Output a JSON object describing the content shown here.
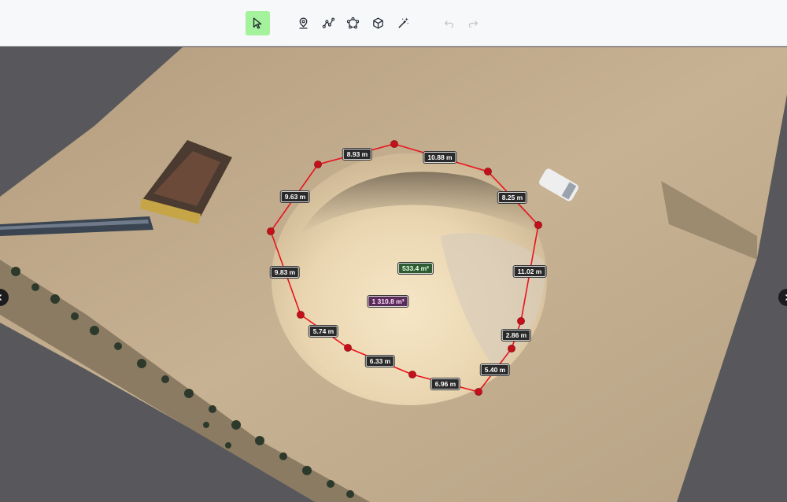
{
  "toolbar": {
    "tools": [
      {
        "name": "select-tool",
        "icon": "cursor-arrow-icon",
        "active": true
      },
      {
        "name": "location-marker-tool",
        "icon": "map-pin-icon",
        "active": false
      },
      {
        "name": "polyline-measure-tool",
        "icon": "polyline-icon",
        "active": false
      },
      {
        "name": "polygon-area-tool",
        "icon": "polygon-icon",
        "active": false
      },
      {
        "name": "volume-tool",
        "icon": "cube-icon",
        "active": false
      },
      {
        "name": "magic-wand-tool",
        "icon": "magic-wand-icon",
        "active": false
      },
      {
        "name": "undo-button",
        "icon": "undo-icon",
        "active": false
      },
      {
        "name": "redo-button",
        "icon": "redo-icon",
        "active": false
      }
    ],
    "active_color": "#a4f29c"
  },
  "measurements": {
    "segments": [
      "8.93 m",
      "10.88 m",
      "8.25 m",
      "11.02 m",
      "2.86 m",
      "5.40 m",
      "6.96 m",
      "6.33 m",
      "5.74 m",
      "9.83 m",
      "9.63 m"
    ],
    "area": "533.4 m²",
    "volume": "1 310.8 m³"
  },
  "colors": {
    "outline": "#e8141c",
    "vertex": "#c4101a",
    "background": "#58585c",
    "toolbar": "#f7f8f9"
  },
  "navigation": {
    "left_icon": "chevron-left-icon",
    "right_icon": "chevron-right-icon"
  }
}
